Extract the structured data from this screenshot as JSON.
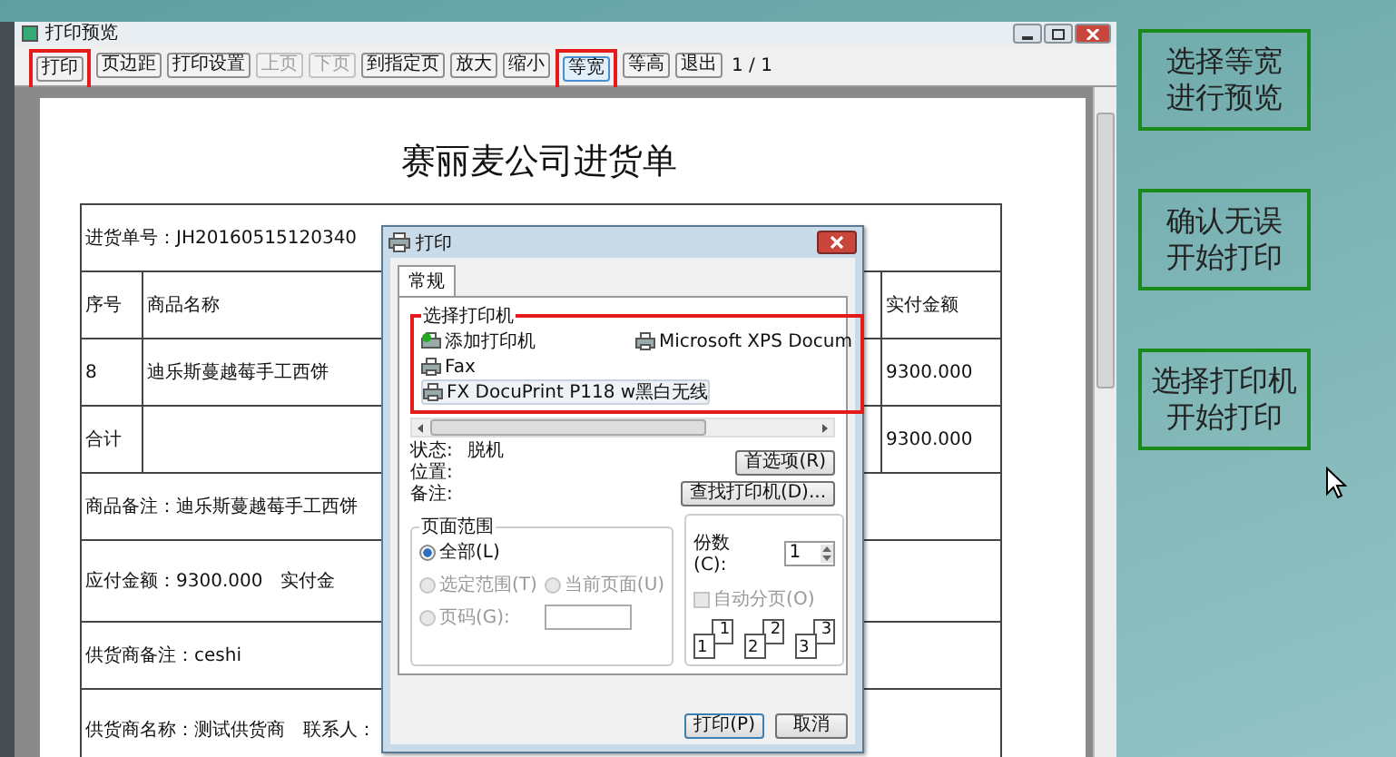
{
  "preview_window": {
    "title": "打印预览",
    "toolbar": [
      {
        "label": "打印",
        "disabled": false,
        "selected": false,
        "highlighted": true
      },
      {
        "label": "页边距",
        "disabled": false,
        "selected": false,
        "highlighted": false
      },
      {
        "label": "打印设置",
        "disabled": false,
        "selected": false,
        "highlighted": false
      },
      {
        "label": "上页",
        "disabled": true,
        "selected": false,
        "highlighted": false
      },
      {
        "label": "下页",
        "disabled": true,
        "selected": false,
        "highlighted": false
      },
      {
        "label": "到指定页",
        "disabled": false,
        "selected": false,
        "highlighted": false
      },
      {
        "label": "放大",
        "disabled": false,
        "selected": false,
        "highlighted": false
      },
      {
        "label": "缩小",
        "disabled": false,
        "selected": false,
        "highlighted": false
      },
      {
        "label": "等宽",
        "disabled": false,
        "selected": true,
        "highlighted": true
      },
      {
        "label": "等高",
        "disabled": false,
        "selected": false,
        "highlighted": false
      },
      {
        "label": "退出",
        "disabled": false,
        "selected": false,
        "highlighted": false
      }
    ],
    "page_indicator": "1 / 1"
  },
  "document": {
    "title": "赛丽麦公司进货单",
    "rows": [
      {
        "kind": "full",
        "text": "进货单号：JH20160515120340"
      },
      {
        "kind": "items",
        "first": "序号",
        "second": "商品名称",
        "last": "实付金额"
      },
      {
        "kind": "items",
        "first": "8",
        "second": "迪乐斯蔓越莓手工西饼",
        "last": "9300.000"
      },
      {
        "kind": "items",
        "first": "合计",
        "last": "9300.000"
      },
      {
        "kind": "full",
        "text": "商品备注：迪乐斯蔓越莓手工西饼"
      },
      {
        "kind": "pair",
        "text": "应付金额：9300.000",
        "second": "实付金"
      },
      {
        "kind": "full",
        "text": "供货商备注：ceshi"
      },
      {
        "kind": "pair",
        "text": "供货商名称：测试供货商",
        "second": "联系人："
      }
    ]
  },
  "print_dialog": {
    "title": "打印",
    "tabs": [
      {
        "label": "常规",
        "selected": true
      }
    ],
    "printer_group": {
      "label": "选择打印机",
      "highlighted": true,
      "printers": [
        {
          "name": "添加打印机",
          "kind": "add",
          "selected": false
        },
        {
          "name": "Fax",
          "kind": "printer",
          "selected": false
        },
        {
          "name": "FX DocuPrint P118 w黑白无线",
          "kind": "printer",
          "selected": true
        },
        {
          "name": "Microsoft XPS Docum",
          "kind": "printer",
          "selected": false
        }
      ]
    },
    "status": [
      {
        "label": "状态:",
        "value": "脱机"
      },
      {
        "label": "位置:"
      },
      {
        "label": "备注:"
      }
    ],
    "preferences_button": "首选项(R)",
    "find_button": "查找打印机(D)...",
    "page_range": {
      "label": "页面范围",
      "options": [
        {
          "label": "全部(L)",
          "selected": true,
          "disabled": false
        },
        {
          "label": "选定范围(T)",
          "selected": false,
          "disabled": true
        },
        {
          "label": "当前页面(U)",
          "selected": false,
          "disabled": true
        },
        {
          "label": "页码(G):",
          "selected": false,
          "disabled": true
        }
      ]
    },
    "copies": {
      "label": "份数(C):",
      "value": "1"
    },
    "collate": {
      "label": "自动分页(O)",
      "checked": false,
      "disabled": true
    },
    "collate_pages": [
      "1",
      "1",
      "2",
      "2",
      "3",
      "3"
    ],
    "buttons": [
      {
        "label": "打印(P)",
        "default": true
      },
      {
        "label": "取消",
        "default": false
      }
    ]
  },
  "annotations": [
    {
      "lines": [
        "选择等宽",
        "进行预览"
      ]
    },
    {
      "lines": [
        "确认无误",
        "开始打印"
      ]
    },
    {
      "lines": [
        "选择打印机",
        "开始打印"
      ]
    }
  ]
}
